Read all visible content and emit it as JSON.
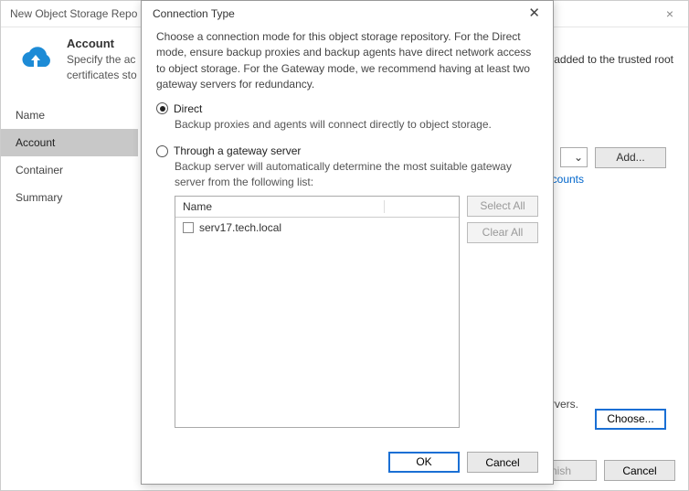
{
  "bg": {
    "window_title": "New Object Storage Repo",
    "header_title": "Account",
    "header_desc_1": "Specify the ac",
    "header_desc_2": "certificates sto",
    "header_desc_tail": "added to the trusted root",
    "nav": {
      "name": "Name",
      "account": "Account",
      "container": "Container",
      "summary": "Summary"
    },
    "add_btn": "Add...",
    "link_text": "ccounts",
    "body_snippet": "way servers.",
    "choose_btn": "Choose...",
    "finish_btn": "nish",
    "cancel_btn": "Cancel"
  },
  "modal": {
    "title": "Connection Type",
    "desc": "Choose a connection mode for this object storage repository. For the Direct mode, ensure backup proxies and backup agents have direct network access to object storage. For the Gateway mode, we recommend having at least two gateway servers for redundancy.",
    "direct": {
      "label": "Direct",
      "desc": "Backup proxies and agents will connect directly to object storage."
    },
    "gateway": {
      "label": "Through a gateway server",
      "desc": "Backup server will automatically determine the most suitable gateway server from the following list:"
    },
    "list_header": "Name",
    "list_item": "serv17.tech.local",
    "select_all": "Select All",
    "clear_all": "Clear All",
    "ok": "OK",
    "cancel": "Cancel"
  }
}
